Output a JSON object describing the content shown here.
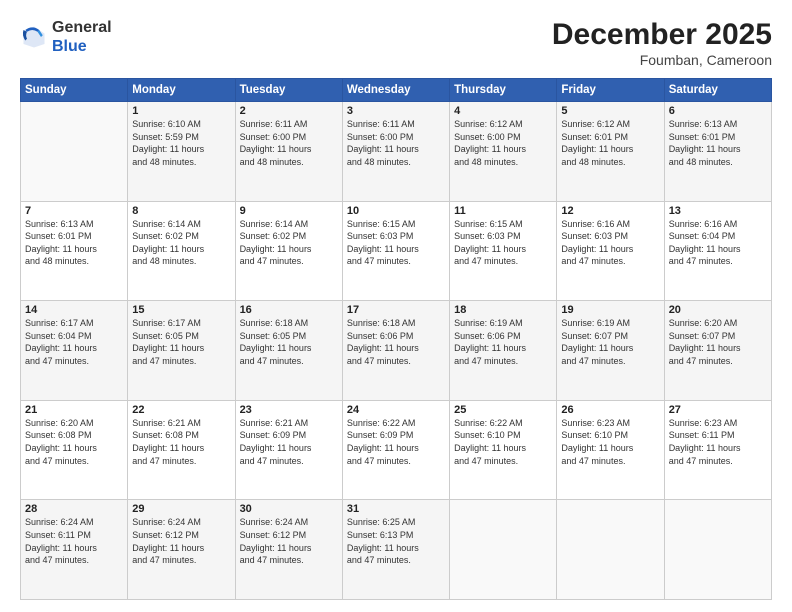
{
  "header": {
    "logo_general": "General",
    "logo_blue": "Blue",
    "month_title": "December 2025",
    "location": "Foumban, Cameroon"
  },
  "days_of_week": [
    "Sunday",
    "Monday",
    "Tuesday",
    "Wednesday",
    "Thursday",
    "Friday",
    "Saturday"
  ],
  "weeks": [
    [
      {
        "day": "",
        "info": ""
      },
      {
        "day": "1",
        "info": "Sunrise: 6:10 AM\nSunset: 5:59 PM\nDaylight: 11 hours\nand 48 minutes."
      },
      {
        "day": "2",
        "info": "Sunrise: 6:11 AM\nSunset: 6:00 PM\nDaylight: 11 hours\nand 48 minutes."
      },
      {
        "day": "3",
        "info": "Sunrise: 6:11 AM\nSunset: 6:00 PM\nDaylight: 11 hours\nand 48 minutes."
      },
      {
        "day": "4",
        "info": "Sunrise: 6:12 AM\nSunset: 6:00 PM\nDaylight: 11 hours\nand 48 minutes."
      },
      {
        "day": "5",
        "info": "Sunrise: 6:12 AM\nSunset: 6:01 PM\nDaylight: 11 hours\nand 48 minutes."
      },
      {
        "day": "6",
        "info": "Sunrise: 6:13 AM\nSunset: 6:01 PM\nDaylight: 11 hours\nand 48 minutes."
      }
    ],
    [
      {
        "day": "7",
        "info": "Sunrise: 6:13 AM\nSunset: 6:01 PM\nDaylight: 11 hours\nand 48 minutes."
      },
      {
        "day": "8",
        "info": "Sunrise: 6:14 AM\nSunset: 6:02 PM\nDaylight: 11 hours\nand 48 minutes."
      },
      {
        "day": "9",
        "info": "Sunrise: 6:14 AM\nSunset: 6:02 PM\nDaylight: 11 hours\nand 47 minutes."
      },
      {
        "day": "10",
        "info": "Sunrise: 6:15 AM\nSunset: 6:03 PM\nDaylight: 11 hours\nand 47 minutes."
      },
      {
        "day": "11",
        "info": "Sunrise: 6:15 AM\nSunset: 6:03 PM\nDaylight: 11 hours\nand 47 minutes."
      },
      {
        "day": "12",
        "info": "Sunrise: 6:16 AM\nSunset: 6:03 PM\nDaylight: 11 hours\nand 47 minutes."
      },
      {
        "day": "13",
        "info": "Sunrise: 6:16 AM\nSunset: 6:04 PM\nDaylight: 11 hours\nand 47 minutes."
      }
    ],
    [
      {
        "day": "14",
        "info": "Sunrise: 6:17 AM\nSunset: 6:04 PM\nDaylight: 11 hours\nand 47 minutes."
      },
      {
        "day": "15",
        "info": "Sunrise: 6:17 AM\nSunset: 6:05 PM\nDaylight: 11 hours\nand 47 minutes."
      },
      {
        "day": "16",
        "info": "Sunrise: 6:18 AM\nSunset: 6:05 PM\nDaylight: 11 hours\nand 47 minutes."
      },
      {
        "day": "17",
        "info": "Sunrise: 6:18 AM\nSunset: 6:06 PM\nDaylight: 11 hours\nand 47 minutes."
      },
      {
        "day": "18",
        "info": "Sunrise: 6:19 AM\nSunset: 6:06 PM\nDaylight: 11 hours\nand 47 minutes."
      },
      {
        "day": "19",
        "info": "Sunrise: 6:19 AM\nSunset: 6:07 PM\nDaylight: 11 hours\nand 47 minutes."
      },
      {
        "day": "20",
        "info": "Sunrise: 6:20 AM\nSunset: 6:07 PM\nDaylight: 11 hours\nand 47 minutes."
      }
    ],
    [
      {
        "day": "21",
        "info": "Sunrise: 6:20 AM\nSunset: 6:08 PM\nDaylight: 11 hours\nand 47 minutes."
      },
      {
        "day": "22",
        "info": "Sunrise: 6:21 AM\nSunset: 6:08 PM\nDaylight: 11 hours\nand 47 minutes."
      },
      {
        "day": "23",
        "info": "Sunrise: 6:21 AM\nSunset: 6:09 PM\nDaylight: 11 hours\nand 47 minutes."
      },
      {
        "day": "24",
        "info": "Sunrise: 6:22 AM\nSunset: 6:09 PM\nDaylight: 11 hours\nand 47 minutes."
      },
      {
        "day": "25",
        "info": "Sunrise: 6:22 AM\nSunset: 6:10 PM\nDaylight: 11 hours\nand 47 minutes."
      },
      {
        "day": "26",
        "info": "Sunrise: 6:23 AM\nSunset: 6:10 PM\nDaylight: 11 hours\nand 47 minutes."
      },
      {
        "day": "27",
        "info": "Sunrise: 6:23 AM\nSunset: 6:11 PM\nDaylight: 11 hours\nand 47 minutes."
      }
    ],
    [
      {
        "day": "28",
        "info": "Sunrise: 6:24 AM\nSunset: 6:11 PM\nDaylight: 11 hours\nand 47 minutes."
      },
      {
        "day": "29",
        "info": "Sunrise: 6:24 AM\nSunset: 6:12 PM\nDaylight: 11 hours\nand 47 minutes."
      },
      {
        "day": "30",
        "info": "Sunrise: 6:24 AM\nSunset: 6:12 PM\nDaylight: 11 hours\nand 47 minutes."
      },
      {
        "day": "31",
        "info": "Sunrise: 6:25 AM\nSunset: 6:13 PM\nDaylight: 11 hours\nand 47 minutes."
      },
      {
        "day": "",
        "info": ""
      },
      {
        "day": "",
        "info": ""
      },
      {
        "day": "",
        "info": ""
      }
    ]
  ]
}
